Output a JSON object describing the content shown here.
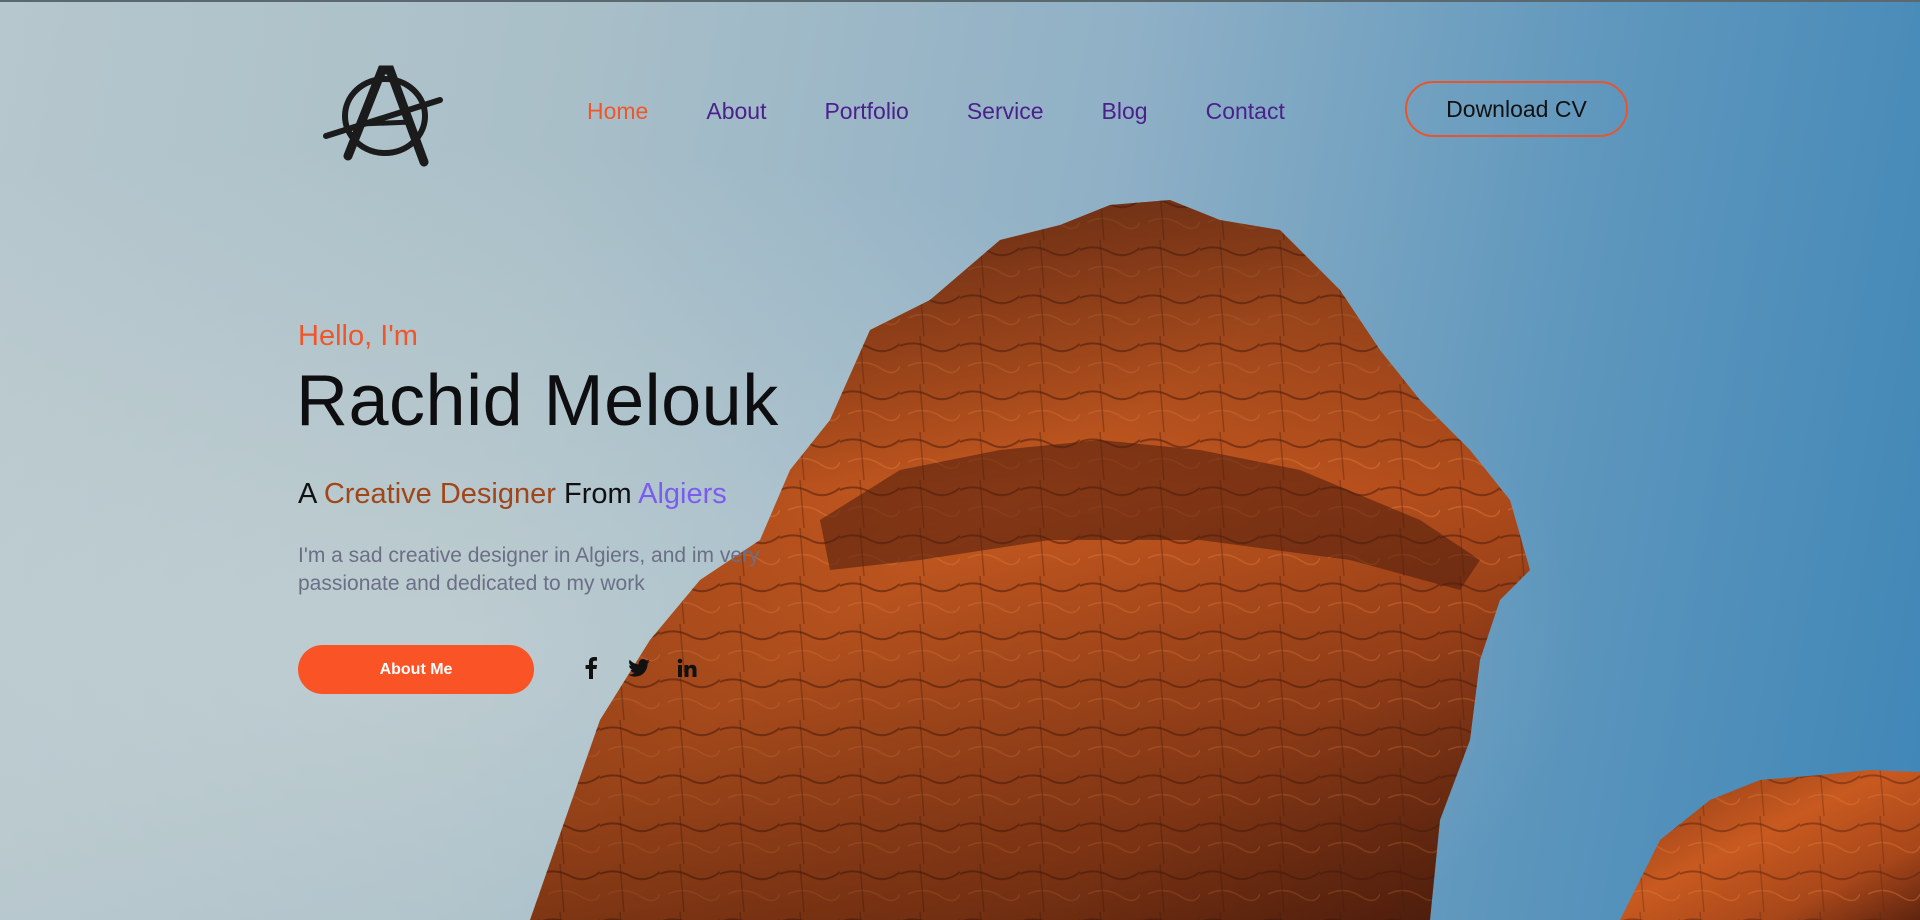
{
  "nav": {
    "items": [
      {
        "label": "Home",
        "active": true
      },
      {
        "label": "About",
        "active": false
      },
      {
        "label": "Portfolio",
        "active": false
      },
      {
        "label": "Service",
        "active": false
      },
      {
        "label": "Blog",
        "active": false
      },
      {
        "label": "Contact",
        "active": false
      }
    ],
    "cta_label": "Download CV"
  },
  "hero": {
    "greeting": "Hello, I'm",
    "name": "Rachid Melouk",
    "tagline_prefix": "A",
    "tagline_role": "Creative Designer",
    "tagline_mid": "From",
    "tagline_city": "Algiers",
    "description": "I'm a sad creative designer in Algiers, and im very passionate and dedicated to my work",
    "button_label": "About Me"
  },
  "socials": [
    {
      "name": "facebook-icon"
    },
    {
      "name": "twitter-icon"
    },
    {
      "name": "linkedin-icon"
    }
  ],
  "colors": {
    "accent": "#f95326",
    "nav_link": "#4b1f8c",
    "role": "#a1451a",
    "city": "#7b5cf0"
  }
}
